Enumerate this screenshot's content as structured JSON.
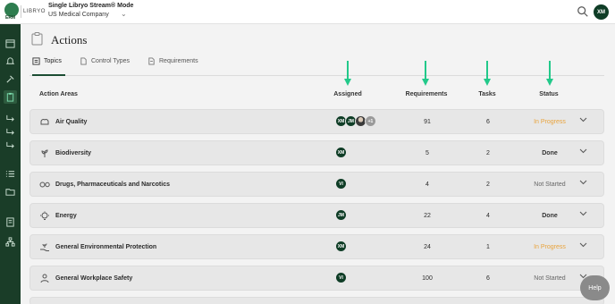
{
  "header": {
    "logo_small": "ERM",
    "logo_brand": "LIBRYO",
    "mode_title": "Single Libryo Stream® Mode",
    "company": "US Medical Company",
    "user_initials": "XM"
  },
  "sidebar": {
    "items": [
      {
        "icon": "calendar-icon"
      },
      {
        "icon": "bell-icon"
      },
      {
        "icon": "hammer-icon"
      },
      {
        "icon": "clipboard-icon",
        "active": true
      },
      {
        "icon": "arrow-return-icon"
      },
      {
        "icon": "arrow-return-icon"
      },
      {
        "icon": "arrow-return-icon"
      },
      {
        "icon": "checklist-icon"
      },
      {
        "icon": "folder-icon"
      },
      {
        "icon": "book-icon"
      },
      {
        "icon": "hierarchy-icon"
      }
    ]
  },
  "page": {
    "title": "Actions"
  },
  "tabs": [
    {
      "label": "Topics",
      "active": true
    },
    {
      "label": "Control Types",
      "active": false
    },
    {
      "label": "Requirements",
      "active": false
    }
  ],
  "columns": {
    "action_areas": "Action Areas",
    "assigned": "Assigned",
    "requirements": "Requirements",
    "tasks": "Tasks",
    "status": "Status"
  },
  "rows": [
    {
      "name": "Air Quality",
      "icon": "cloud-icon",
      "assigned": [
        "XM",
        "JM",
        "photo",
        "+1"
      ],
      "requirements": "91",
      "tasks": "6",
      "status": "In Progress"
    },
    {
      "name": "Biodiversity",
      "icon": "plant-icon",
      "assigned": [
        "XM"
      ],
      "requirements": "5",
      "tasks": "2",
      "status": "Done"
    },
    {
      "name": "Drugs, Pharmaceuticals and Narcotics",
      "icon": "pills-icon",
      "assigned": [
        "VI"
      ],
      "requirements": "4",
      "tasks": "2",
      "status": "Not Started"
    },
    {
      "name": "Energy",
      "icon": "bulb-icon",
      "assigned": [
        "JM"
      ],
      "requirements": "22",
      "tasks": "4",
      "status": "Done"
    },
    {
      "name": "General Environmental Protection",
      "icon": "leaf-hand-icon",
      "assigned": [
        "XM"
      ],
      "requirements": "24",
      "tasks": "1",
      "status": "In Progress"
    },
    {
      "name": "General Workplace Safety",
      "icon": "worker-icon",
      "assigned": [
        "VI"
      ],
      "requirements": "100",
      "tasks": "6",
      "status": "Not Started"
    }
  ],
  "help": {
    "label": "Help"
  },
  "colors": {
    "sidebar": "#1a3d28",
    "accent": "#1b4d33",
    "arrow": "#22c98a",
    "in_progress": "#e8a33c"
  }
}
